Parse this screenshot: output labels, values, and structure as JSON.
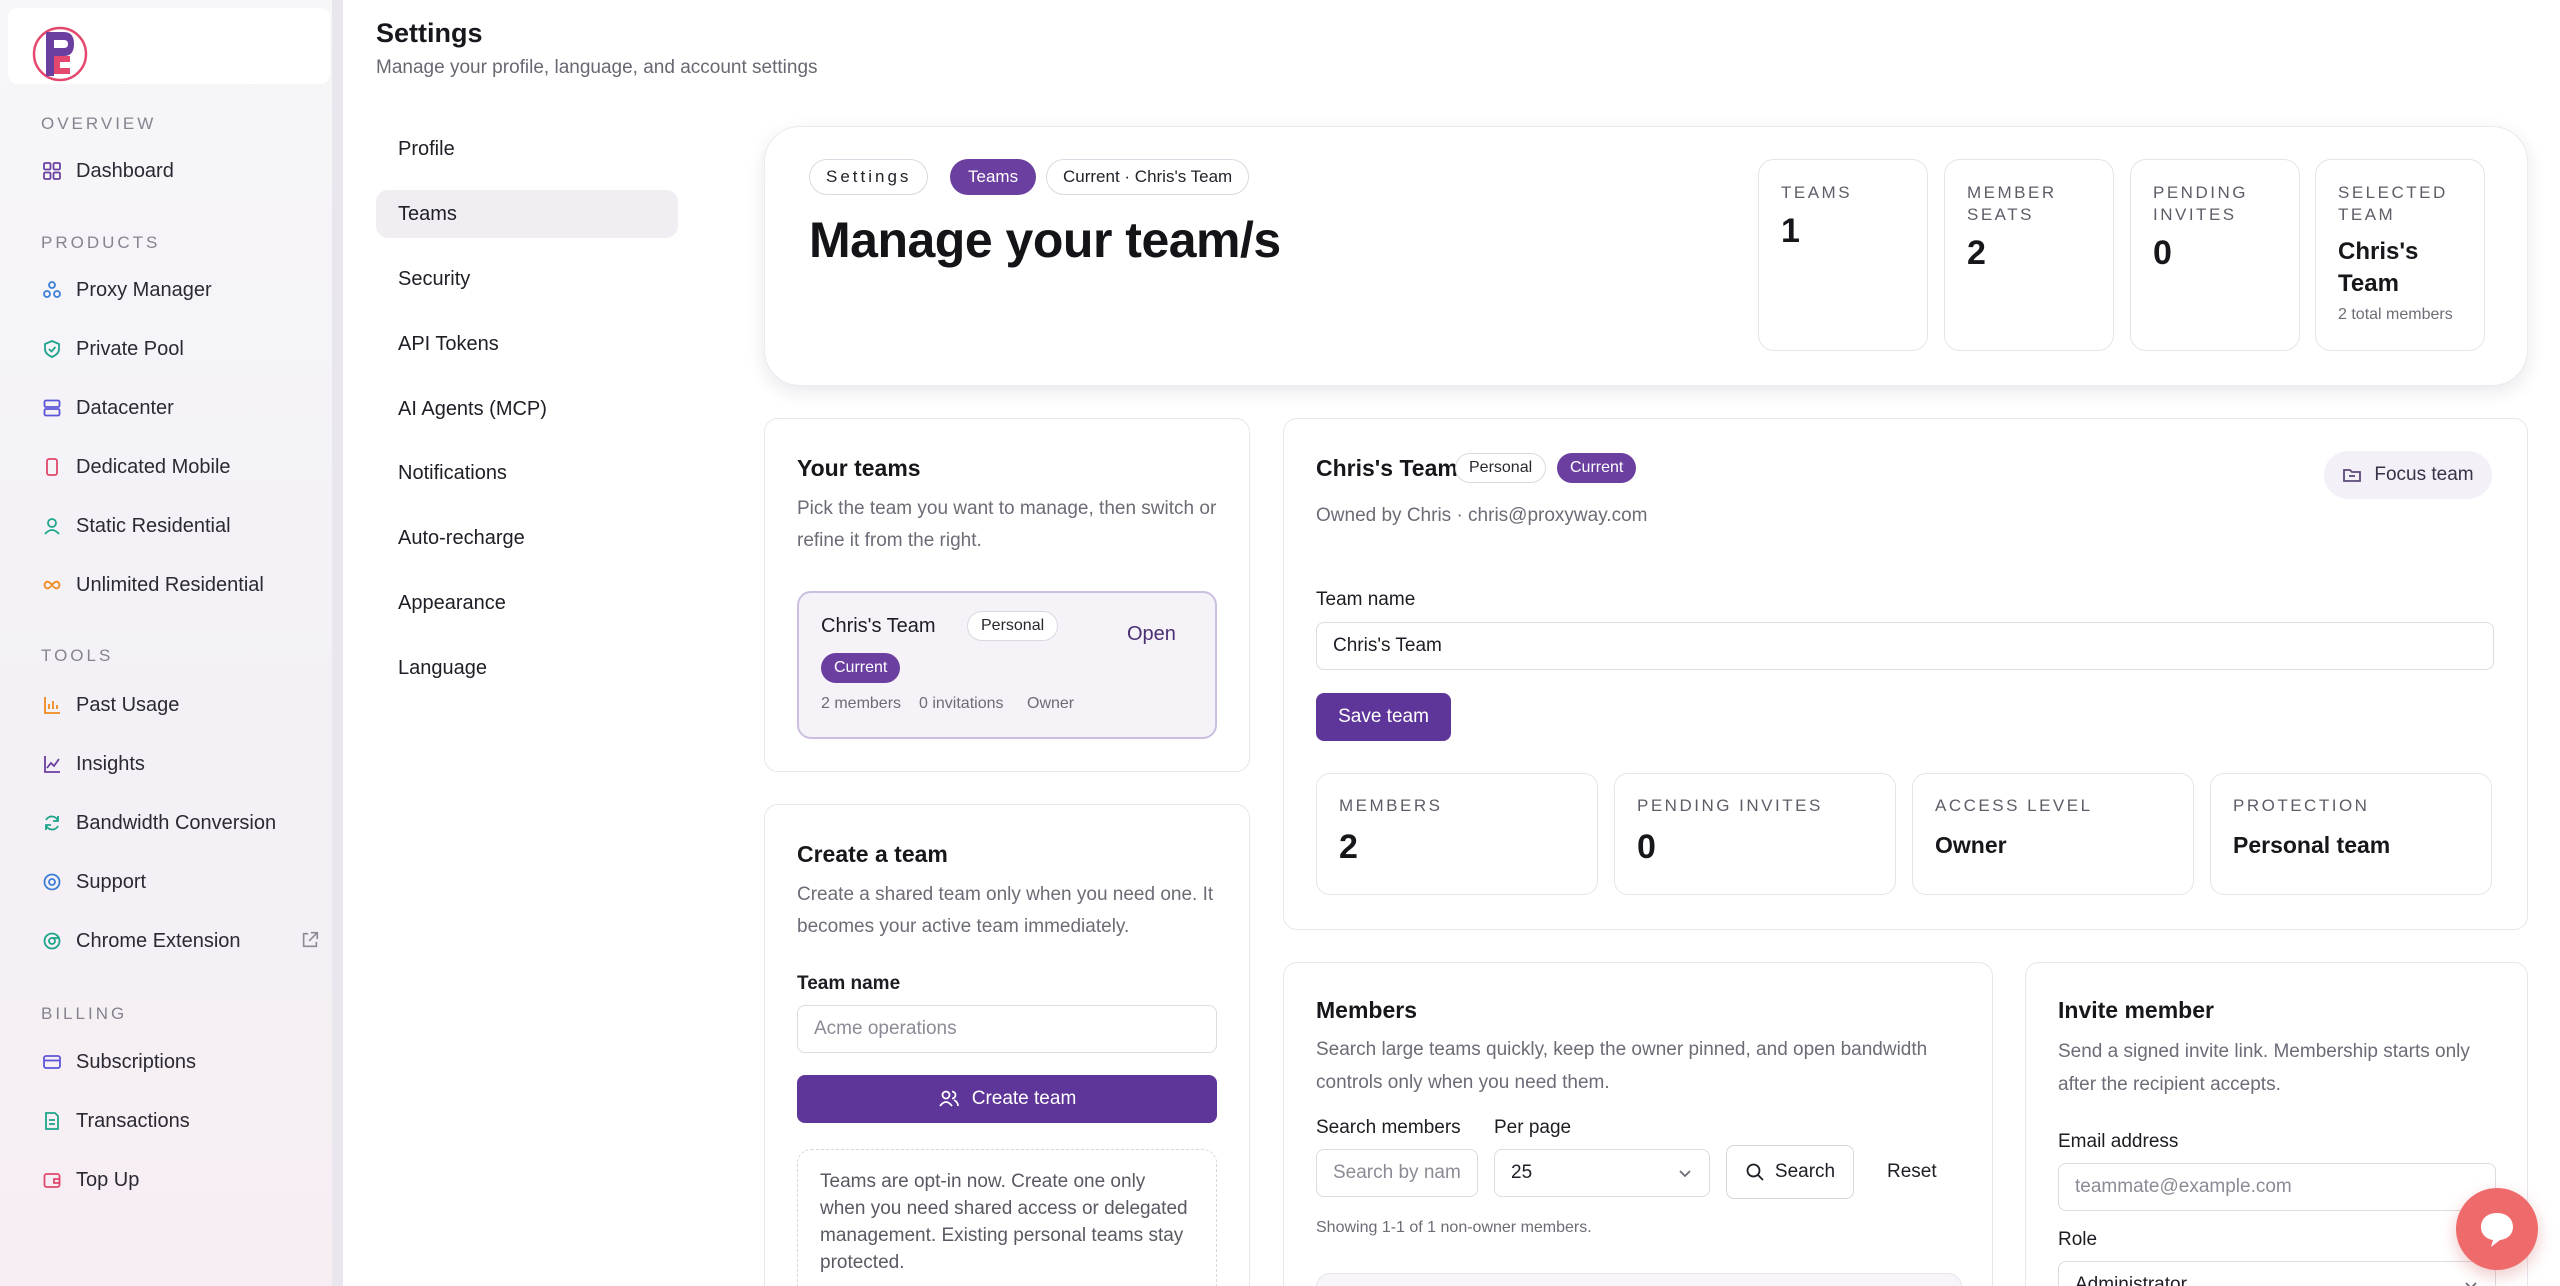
{
  "sidebar": {
    "sections": [
      {
        "label": "OVERVIEW",
        "items": [
          {
            "label": "Dashboard",
            "icon": "grid-icon"
          }
        ]
      },
      {
        "label": "PRODUCTS",
        "items": [
          {
            "label": "Proxy Manager",
            "icon": "nodes-icon"
          },
          {
            "label": "Private Pool",
            "icon": "shield-icon"
          },
          {
            "label": "Datacenter",
            "icon": "server-icon"
          },
          {
            "label": "Dedicated Mobile",
            "icon": "phone-icon"
          },
          {
            "label": "Static Residential",
            "icon": "user-pin-icon"
          },
          {
            "label": "Unlimited Residential",
            "icon": "infinity-icon"
          }
        ]
      },
      {
        "label": "TOOLS",
        "items": [
          {
            "label": "Past Usage",
            "icon": "bar-chart-icon"
          },
          {
            "label": "Insights",
            "icon": "line-chart-icon"
          },
          {
            "label": "Bandwidth Conversion",
            "icon": "refresh-icon"
          },
          {
            "label": "Support",
            "icon": "lifebuoy-icon"
          },
          {
            "label": "Chrome Extension",
            "icon": "chrome-icon"
          }
        ]
      },
      {
        "label": "BILLING",
        "items": [
          {
            "label": "Subscriptions",
            "icon": "card-icon"
          },
          {
            "label": "Transactions",
            "icon": "receipt-icon"
          },
          {
            "label": "Top Up",
            "icon": "wallet-icon"
          }
        ]
      }
    ]
  },
  "header": {
    "title": "Settings",
    "subtitle": "Manage your profile, language, and account settings"
  },
  "settings_nav": {
    "items": [
      "Profile",
      "Teams",
      "Security",
      "API Tokens",
      "AI Agents (MCP)",
      "Notifications",
      "Auto-recharge",
      "Appearance",
      "Language"
    ],
    "active": "Teams"
  },
  "hero": {
    "pills": [
      "Settings",
      "Teams",
      "Current · Chris's Team"
    ],
    "title": "Manage your team/s",
    "stats": [
      {
        "label": "TEAMS",
        "value": "1"
      },
      {
        "label": "MEMBER SEATS",
        "value": "2"
      },
      {
        "label": "PENDING INVITES",
        "value": "0"
      },
      {
        "label": "SELECTED TEAM",
        "value": "Chris's Team",
        "sub": "2 total members"
      }
    ]
  },
  "your_teams": {
    "title": "Your teams",
    "description": "Pick the team you want to manage, then switch or refine it from the right.",
    "team": {
      "name": "Chris's Team",
      "tag_personal": "Personal",
      "tag_current": "Current",
      "open_label": "Open",
      "members": "2 members",
      "invitations": "0 invitations",
      "role": "Owner"
    }
  },
  "create_team": {
    "title": "Create a team",
    "description": "Create a shared team only when you need one. It becomes your active team immediately.",
    "field_label": "Team name",
    "placeholder": "Acme operations",
    "button_label": "Create team",
    "note": "Teams are opt-in now. Create one only when you need shared access or delegated management. Existing personal teams stay protected."
  },
  "team_detail": {
    "name": "Chris's Team",
    "tag_personal": "Personal",
    "tag_current": "Current",
    "owner_line": "Owned by Chris · chris@proxyway.com",
    "focus_label": "Focus team",
    "field_label": "Team name",
    "field_value": "Chris's Team",
    "save_label": "Save team",
    "stats": [
      {
        "label": "MEMBERS",
        "value": "2"
      },
      {
        "label": "PENDING INVITES",
        "value": "0"
      },
      {
        "label": "ACCESS LEVEL",
        "value": "Owner"
      },
      {
        "label": "PROTECTION",
        "value": "Personal team"
      }
    ]
  },
  "members": {
    "title": "Members",
    "description": "Search large teams quickly, keep the owner pinned, and open bandwidth controls only when you need them.",
    "search_label": "Search members",
    "search_placeholder": "Search by name",
    "per_page_label": "Per page",
    "per_page_value": "25",
    "search_button": "Search",
    "reset_button": "Reset",
    "showing": "Showing 1-1 of 1 non-owner members."
  },
  "invite": {
    "title": "Invite member",
    "description": "Send a signed invite link. Membership starts only after the recipient accepts.",
    "email_label": "Email address",
    "email_placeholder": "teammate@example.com",
    "role_label": "Role",
    "role_value": "Administrator"
  },
  "colors": {
    "accent": "#6b3fa0",
    "accent_dark": "#5e3598",
    "chat": "#ef6b6b"
  }
}
